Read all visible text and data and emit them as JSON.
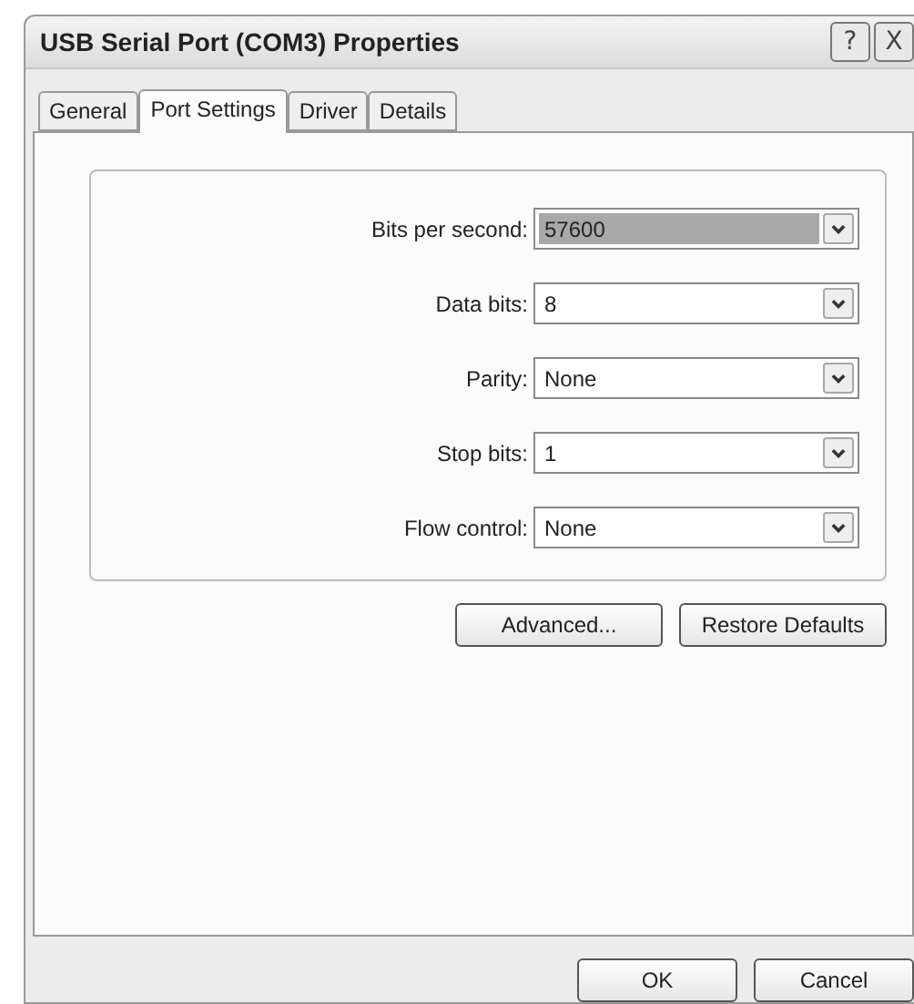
{
  "window": {
    "title": "USB Serial Port (COM3) Properties",
    "help_button": "?",
    "close_button": "X"
  },
  "tabs": [
    {
      "label": "General",
      "selected": false
    },
    {
      "label": "Port Settings",
      "selected": true
    },
    {
      "label": "Driver",
      "selected": false
    },
    {
      "label": "Details",
      "selected": false
    }
  ],
  "settings": [
    {
      "label": "Bits per second:",
      "value": "57600",
      "highlighted": true
    },
    {
      "label": "Data bits:",
      "value": "8",
      "highlighted": false
    },
    {
      "label": "Parity:",
      "value": "None",
      "highlighted": false
    },
    {
      "label": "Stop bits:",
      "value": "1",
      "highlighted": false
    },
    {
      "label": "Flow control:",
      "value": "None",
      "highlighted": false
    }
  ],
  "panel_buttons": [
    "Advanced...",
    "Restore Defaults"
  ],
  "dialog_buttons": [
    "OK",
    "Cancel"
  ]
}
